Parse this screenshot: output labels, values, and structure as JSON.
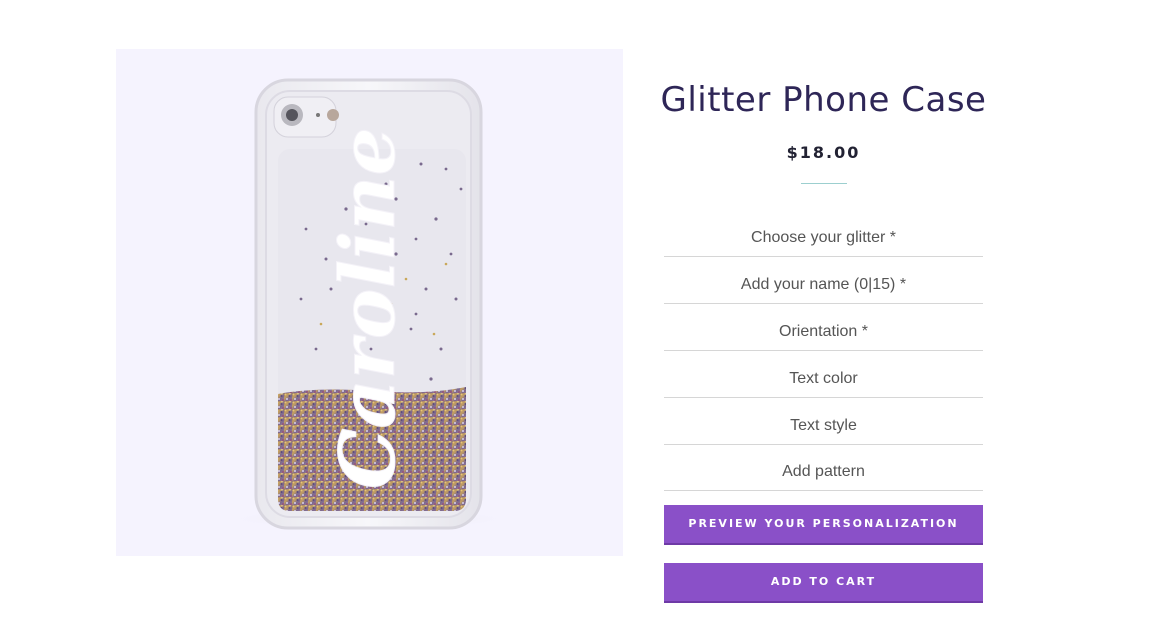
{
  "product": {
    "title": "Glitter Phone Case",
    "price": "$18.00",
    "image": {
      "background_color": "#f5f3fe",
      "engraved_name": "Caroline"
    }
  },
  "options": [
    {
      "label": "Choose your glitter *"
    },
    {
      "label": "Add your name (0|15) *"
    },
    {
      "label": "Orientation *"
    },
    {
      "label": "Text color"
    },
    {
      "label": "Text style"
    },
    {
      "label": "Add pattern"
    }
  ],
  "buttons": {
    "preview_label": "PREVIEW YOUR PERSONALIZATION",
    "add_to_cart_label": "ADD TO CART"
  },
  "colors": {
    "accent": "#8a50c8",
    "title": "#2e2657",
    "divider": "#9ccfcf"
  }
}
